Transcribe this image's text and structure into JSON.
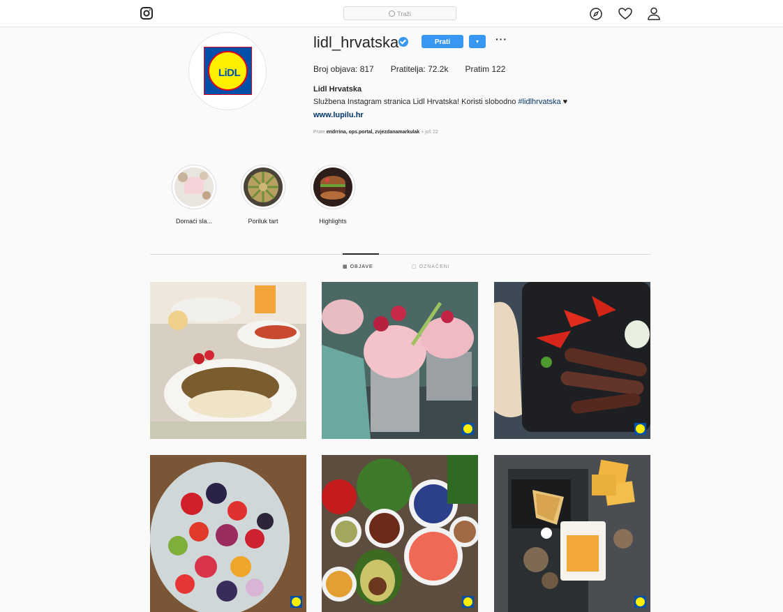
{
  "nav": {
    "search_placeholder": "Traži"
  },
  "profile": {
    "username": "lidl_hrvatska",
    "follow_label": "Prati",
    "dropdown_label": "▾",
    "more_label": "···",
    "posts_label": "Broj objava: 817",
    "followers_label": "Pratitelja: 72.2k",
    "following_label": "Pratim 122",
    "full_name": "Lidl Hrvatska",
    "bio_text": "Službena Instagram stranica Lidl Hrvatska! Koristi slobodno ",
    "bio_tag": "#lidlhrvatska",
    "bio_heart": " ♥",
    "website": "www.lupilu.hr",
    "followed_prefix": "Prate ",
    "followed_names": "endrrina, ops.portal, zvjezdanamarkulak",
    "followed_suffix": " + još 22",
    "logo_text": "LiDL"
  },
  "highlights": [
    {
      "label": "Domaći sla..."
    },
    {
      "label": "Poriluk tart"
    },
    {
      "label": "Highlights"
    }
  ],
  "tabs": {
    "posts": "OBJAVE",
    "tagged": "OZNAČENI"
  },
  "colors": {
    "accent": "#3897f0",
    "lidl_blue": "#0050aa",
    "lidl_yellow": "#fff000",
    "lidl_red": "#e2001a"
  }
}
